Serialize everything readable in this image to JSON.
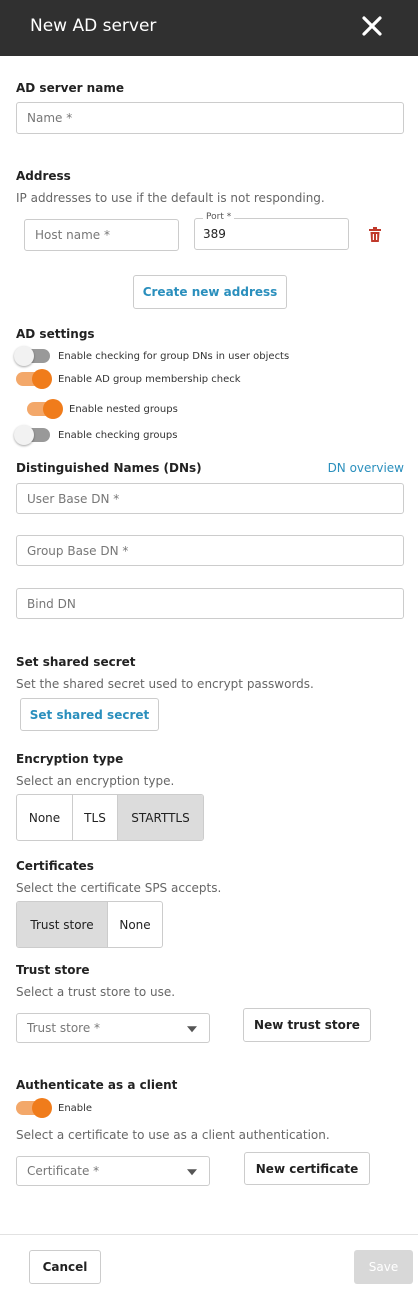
{
  "header": {
    "title": "New AD server"
  },
  "ad_server_name": {
    "section_title": "AD server name",
    "placeholder": "Name *"
  },
  "address": {
    "section_title": "Address",
    "description": "IP addresses to use if the default is not responding.",
    "host_placeholder": "Host name *",
    "port_label": "Port *",
    "port_value": "389",
    "create_button": "Create new address"
  },
  "ad_settings": {
    "section_title": "AD settings",
    "toggles": [
      {
        "label": "Enable checking for group DNs in user objects",
        "state": "off"
      },
      {
        "label": "Enable AD group membership check",
        "state": "on"
      },
      {
        "label": "Enable nested groups",
        "state": "on"
      },
      {
        "label": "Enable checking groups",
        "state": "off"
      }
    ]
  },
  "dns": {
    "section_title": "Distinguished Names (DNs)",
    "overview_link": "DN overview",
    "user_base_placeholder": "User Base DN *",
    "group_base_placeholder": "Group Base DN *",
    "bind_dn_placeholder": "Bind DN"
  },
  "shared_secret": {
    "section_title": "Set shared secret",
    "description": "Set the shared secret used to encrypt passwords.",
    "button": "Set shared secret"
  },
  "encryption": {
    "section_title": "Encryption type",
    "description": "Select an encryption type.",
    "options": [
      "None",
      "TLS",
      "STARTTLS"
    ],
    "selected": "STARTTLS"
  },
  "certificates": {
    "section_title": "Certificates",
    "description": "Select the certificate SPS accepts.",
    "options": [
      "Trust store",
      "None"
    ],
    "selected": "Trust store"
  },
  "trust_store": {
    "section_title": "Trust store",
    "description": "Select a trust store to use.",
    "select_placeholder": "Trust store *",
    "new_button": "New trust store"
  },
  "client_auth": {
    "section_title": "Authenticate as a client",
    "toggle_label": "Enable",
    "toggle_state": "on",
    "description": "Select a certificate to use as a client authentication.",
    "select_placeholder": "Certificate *",
    "new_button": "New certificate"
  },
  "footer": {
    "cancel": "Cancel",
    "save": "Save"
  },
  "colors": {
    "header_bg": "#303030",
    "accent_orange": "#f07c1b",
    "link_blue": "#2a8fbd",
    "delete_red": "#c0392b"
  }
}
